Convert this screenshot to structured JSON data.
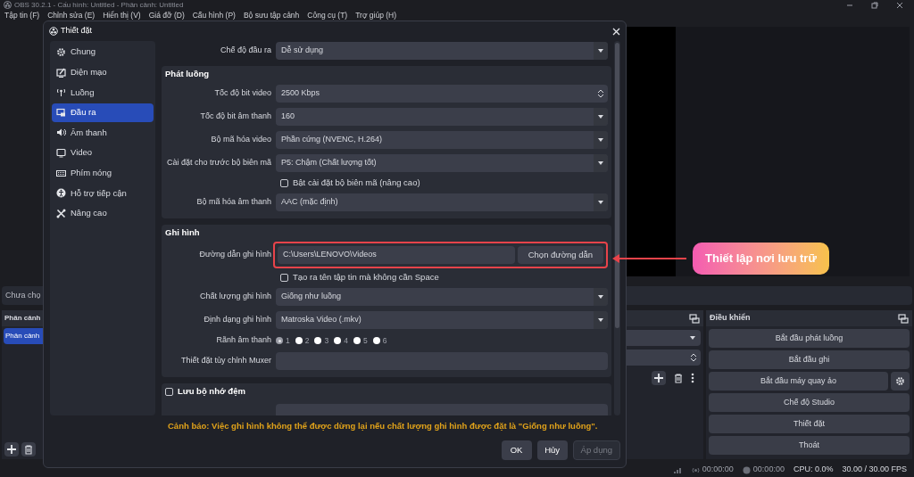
{
  "app": {
    "title": "OBS 30.2.1 - Cấu hình: Untitled - Phân cảnh: Untitled",
    "menu": [
      "Tập tin (F)",
      "Chỉnh sửa (E)",
      "Hiển thị (V)",
      "Giá đỡ (D)",
      "Cấu hình (P)",
      "Bộ sưu tập cảnh",
      "Công cụ (T)",
      "Trợ giúp (H)"
    ],
    "source_bar": "Chưa chọ",
    "scenes": {
      "title": "Phân cảnh",
      "items": [
        {
          "label": "Phân cảnh",
          "selected": true
        }
      ]
    },
    "controls": {
      "title": "Điều khiển",
      "buttons": [
        "Bắt đầu phát luồng",
        "Bắt đầu ghi",
        "Bắt đầu máy quay ảo",
        "Chế độ Studio",
        "Thiết đặt",
        "Thoát"
      ]
    },
    "status": {
      "stream_time": "00:00:00",
      "record_time": "00:00:00",
      "cpu": "CPU: 0.0%",
      "fps": "30.00 / 30.00 FPS"
    }
  },
  "dialog": {
    "title": "Thiết đặt",
    "sidebar": [
      {
        "label": "Chung",
        "selected": false
      },
      {
        "label": "Diện mạo",
        "selected": false
      },
      {
        "label": "Luồng",
        "selected": false
      },
      {
        "label": "Đầu ra",
        "selected": true
      },
      {
        "label": "Âm thanh",
        "selected": false
      },
      {
        "label": "Video",
        "selected": false
      },
      {
        "label": "Phím nóng",
        "selected": false
      },
      {
        "label": "Hỗ trợ tiếp cận",
        "selected": false
      },
      {
        "label": "Nâng cao",
        "selected": false
      }
    ],
    "output_mode": {
      "label": "Chế độ đầu ra",
      "value": "Dễ sử dụng"
    },
    "stream": {
      "title": "Phát luồng",
      "rows": [
        {
          "kind": "spin",
          "label": "Tốc độ bit video",
          "value": "2500 Kbps"
        },
        {
          "kind": "select",
          "label": "Tốc độ bit âm thanh",
          "value": "160"
        },
        {
          "kind": "select",
          "label": "Bộ mã hóa video",
          "value": "Phần cứng (NVENC, H.264)"
        },
        {
          "kind": "select",
          "label": "Cài đặt cho trước bộ biên mã",
          "value": "P5: Chậm (Chất lượng tốt)"
        },
        {
          "kind": "checkbox",
          "label": "Bật cài đặt bộ biên mã (nâng cao)",
          "checked": false
        },
        {
          "kind": "select",
          "label": "Bộ mã hóa âm thanh",
          "value": "AAC (mặc định)"
        }
      ]
    },
    "recording": {
      "title": "Ghi hình",
      "rows": [
        {
          "kind": "path",
          "label": "Đường dẫn ghi hình",
          "value": "C:\\Users\\LENOVO\\Videos",
          "button": "Chọn đường dẫn"
        },
        {
          "kind": "checkbox",
          "label": "Tạo ra tên tập tin mà không cần Space",
          "checked": false
        },
        {
          "kind": "select",
          "label": "Chất lượng ghi hình",
          "value": "Giống như luồng"
        },
        {
          "kind": "select",
          "label": "Định dạng ghi hình",
          "value": "Matroska Video (.mkv)"
        },
        {
          "kind": "radios",
          "label": "Rãnh âm thanh",
          "options": [
            {
              "label": "1",
              "selected": true
            },
            {
              "label": "2",
              "selected": false
            },
            {
              "label": "3",
              "selected": false
            },
            {
              "label": "4",
              "selected": false
            },
            {
              "label": "5",
              "selected": false
            },
            {
              "label": "6",
              "selected": false
            }
          ]
        },
        {
          "kind": "text",
          "label": "Thiết đặt tùy chỉnh Muxer",
          "value": ""
        }
      ]
    },
    "replay_buffer": {
      "title": "Lưu bộ nhớ đệm",
      "checked": false
    },
    "warning": "Cảnh báo: Việc ghi hình không thể được dừng lại nếu chất lượng ghi hình được đặt là \"Giống như luồng\".",
    "buttons": [
      {
        "label": "OK",
        "disabled": false
      },
      {
        "label": "Hủy",
        "disabled": false
      },
      {
        "label": "Áp dụng",
        "disabled": true
      }
    ]
  },
  "annotation": {
    "text": "Thiết lập nơi lưu trữ"
  }
}
